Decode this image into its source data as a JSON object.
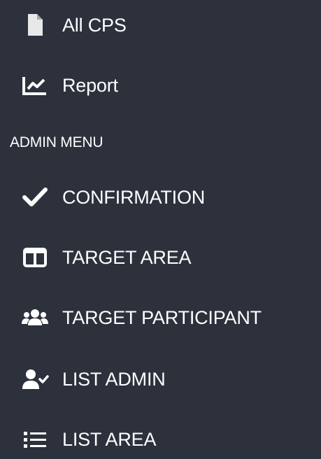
{
  "sidebar": {
    "items_top": [
      {
        "label": "All CPS",
        "icon": "file-icon"
      },
      {
        "label": "Report",
        "icon": "chart-line-icon"
      }
    ],
    "admin_header": "ADMIN MENU",
    "admin_items": [
      {
        "label": "CONFIRMATION",
        "icon": "check-icon"
      },
      {
        "label": "TARGET AREA",
        "icon": "columns-icon"
      },
      {
        "label": "TARGET PARTICIPANT",
        "icon": "users-icon"
      },
      {
        "label": "LIST ADMIN",
        "icon": "user-check-icon"
      },
      {
        "label": "LIST AREA",
        "icon": "list-icon"
      }
    ]
  },
  "colors": {
    "background": "#2c313c",
    "text": "#ffffff"
  }
}
